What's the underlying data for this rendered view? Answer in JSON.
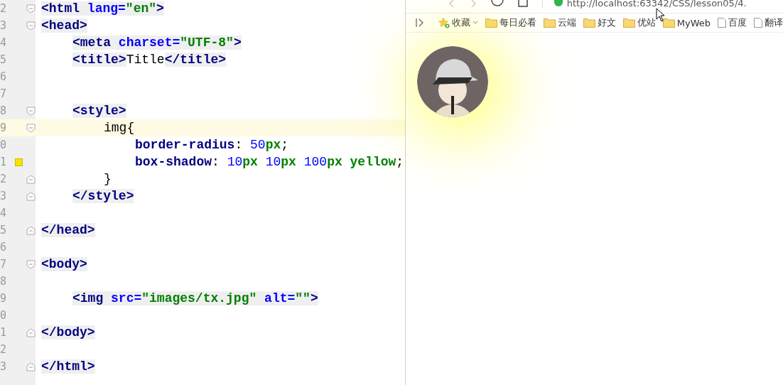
{
  "editor": {
    "lines": [
      {
        "number": "2",
        "kind": "open",
        "current": false,
        "marker": false,
        "text": "<html lang=\"en\">"
      },
      {
        "number": "3",
        "kind": "open",
        "current": false,
        "marker": false,
        "text": "<head>",
        "children": [
          {
            "number": "4",
            "current": false,
            "marker": false,
            "text": "<meta charset=\"UTF-8\">"
          },
          {
            "number": "5",
            "current": false,
            "marker": false,
            "text": "<title>Title</title>"
          },
          {
            "number": "6",
            "current": false,
            "marker": false
          },
          {
            "number": "7",
            "current": false,
            "marker": false
          },
          {
            "number": "8",
            "kind": "open",
            "current": false,
            "marker": false,
            "text": "<style>",
            "children": [
              {
                "number": "9",
                "kind": "open",
                "current": true,
                "marker": false,
                "text": "img{",
                "children": [
                  {
                    "number": "0",
                    "current": false,
                    "marker": false,
                    "text": "border-radius: 50px;"
                  },
                  {
                    "number": "1",
                    "current": false,
                    "marker": true,
                    "text": "box-shadow: 10px 10px 100px yellow;"
                  }
                ]
              },
              {
                "number": "2",
                "kind": "close",
                "current": false,
                "marker": false,
                "text": "}"
              }
            ]
          },
          {
            "number": "3",
            "kind": "close",
            "current": false,
            "marker": false,
            "text": "</style>"
          },
          {
            "number": "4",
            "current": false,
            "marker": false
          }
        ]
      },
      {
        "number": "5",
        "kind": "close",
        "current": false,
        "marker": false,
        "text": "</head>"
      },
      {
        "number": "6",
        "current": false,
        "marker": false
      },
      {
        "number": "7",
        "kind": "open",
        "current": false,
        "marker": false,
        "text": "<body>",
        "children": [
          {
            "number": "8",
            "current": false,
            "marker": false
          },
          {
            "number": "9",
            "current": false,
            "marker": false,
            "text": "<img src=\"images/tx.jpg\" alt=\"\">"
          },
          {
            "number": "0",
            "current": false,
            "marker": false
          }
        ]
      },
      {
        "number": "1",
        "kind": "close",
        "current": false,
        "marker": false,
        "text": "</body>"
      },
      {
        "number": "2",
        "current": false,
        "marker": false
      },
      {
        "number": "3",
        "kind": "close",
        "current": false,
        "marker": false,
        "text": "</html>"
      }
    ]
  },
  "browser": {
    "url": "http://localhost:63342/CSS/lesson05/4.",
    "bookmarks": [
      {
        "kind": "favorites",
        "label": "收藏"
      },
      {
        "kind": "folder",
        "label": "每日必看"
      },
      {
        "kind": "folder",
        "label": "云端"
      },
      {
        "kind": "folder",
        "label": "好文"
      },
      {
        "kind": "folder",
        "label": "优站"
      },
      {
        "kind": "folder",
        "label": "MyWeb"
      },
      {
        "kind": "page",
        "label": "百度"
      },
      {
        "kind": "page",
        "label": "翻译"
      }
    ]
  }
}
